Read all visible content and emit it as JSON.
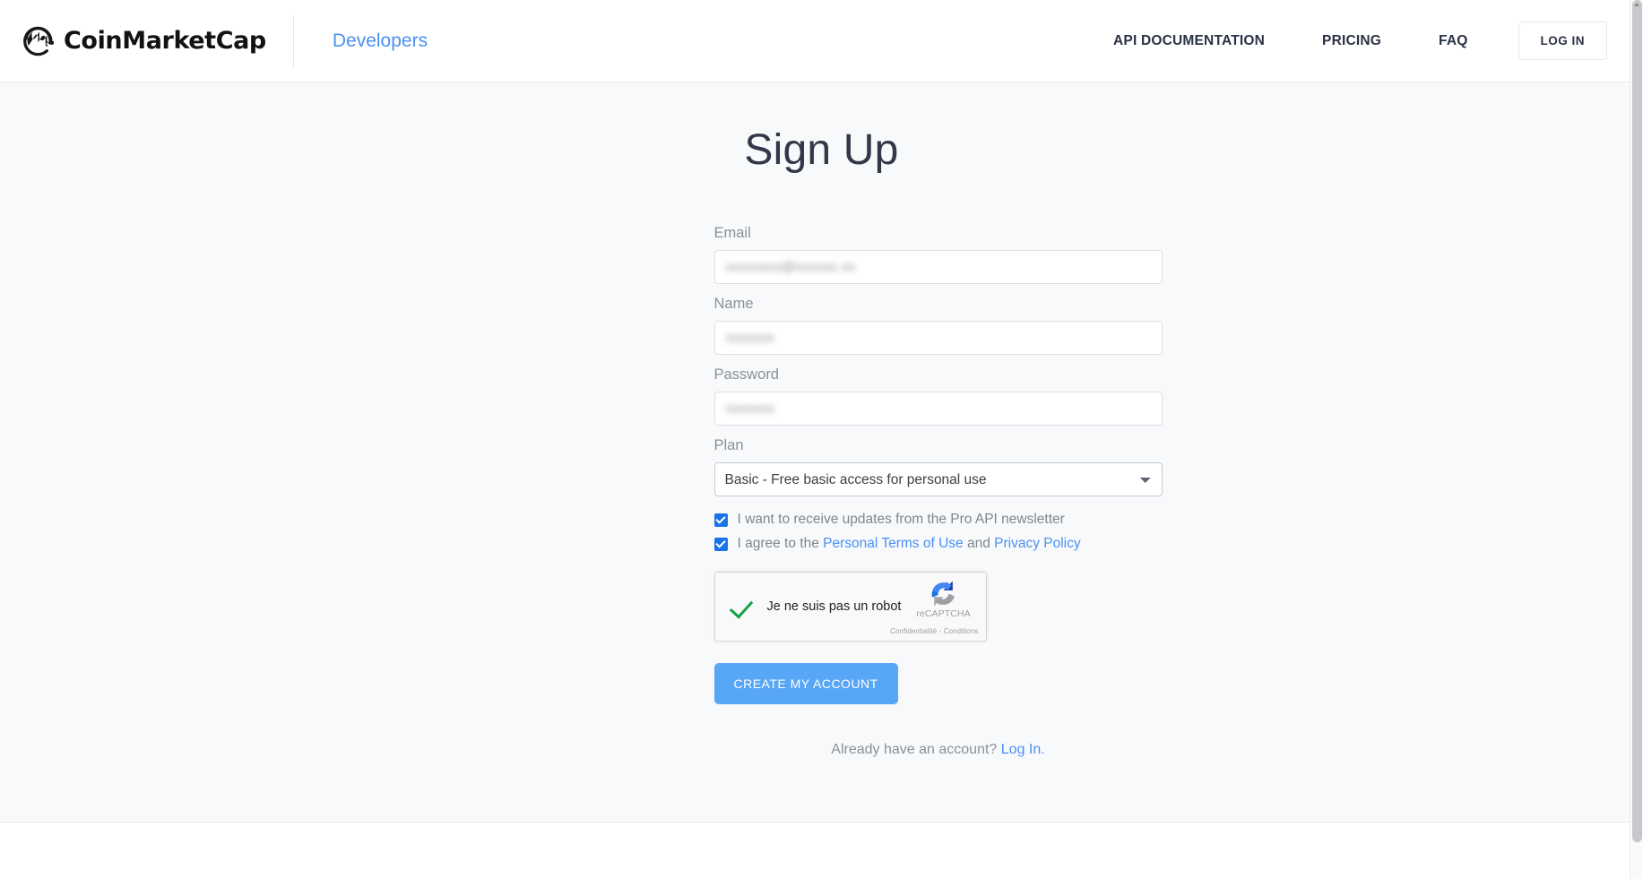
{
  "header": {
    "brand_name": "CoinMarketCap",
    "brand_logo_icon": "coinmarketcap-logo-icon",
    "developers_link": "Developers",
    "nav": [
      {
        "label": "API DOCUMENTATION",
        "name": "nav-api-documentation"
      },
      {
        "label": "PRICING",
        "name": "nav-pricing"
      },
      {
        "label": "FAQ",
        "name": "nav-faq"
      }
    ],
    "login_button": "LOG IN"
  },
  "main": {
    "title": "Sign Up",
    "fields": {
      "email": {
        "label": "Email",
        "value": "xxxxxxxx@xxxxxx.xx",
        "placeholder": ""
      },
      "name": {
        "label": "Name",
        "value": "xxxxxxx",
        "placeholder": ""
      },
      "password": {
        "label": "Password",
        "value": "xxxxxxx",
        "placeholder": ""
      },
      "plan": {
        "label": "Plan",
        "selected": "Basic - Free basic access for personal use",
        "options": [
          "Basic - Free basic access for personal use"
        ],
        "chevron_icon": "chevron-down-icon"
      }
    },
    "checkboxes": [
      {
        "name": "newsletter-checkbox",
        "checked": true,
        "label": "I want to receive updates from the Pro API newsletter"
      },
      {
        "name": "terms-checkbox",
        "checked": true,
        "label_prefix": "I agree to the ",
        "link1": "Personal Terms of Use",
        "label_middle": " and ",
        "link2": "Privacy Policy"
      }
    ],
    "recaptcha": {
      "checkbox_label": "Je ne suis pas un robot",
      "brand": "reCAPTCHA",
      "legal": "Confidentialité - Conditions",
      "verified": true,
      "logo_icon": "recaptcha-logo-icon",
      "check_icon": "green-check-icon"
    },
    "submit_button": "CREATE MY ACCOUNT",
    "already_account_text": "Already have an account? ",
    "login_link": "Log In."
  },
  "colors": {
    "accent_blue": "#4a90f4",
    "button_blue": "#58a6f6",
    "checkbox_blue": "#1a73e8",
    "page_bg": "#f8f9fa",
    "header_bg": "#ffffff",
    "text_dark": "#2b3245",
    "text_muted": "#8b9097",
    "recaptcha_green": "#13a24a"
  }
}
